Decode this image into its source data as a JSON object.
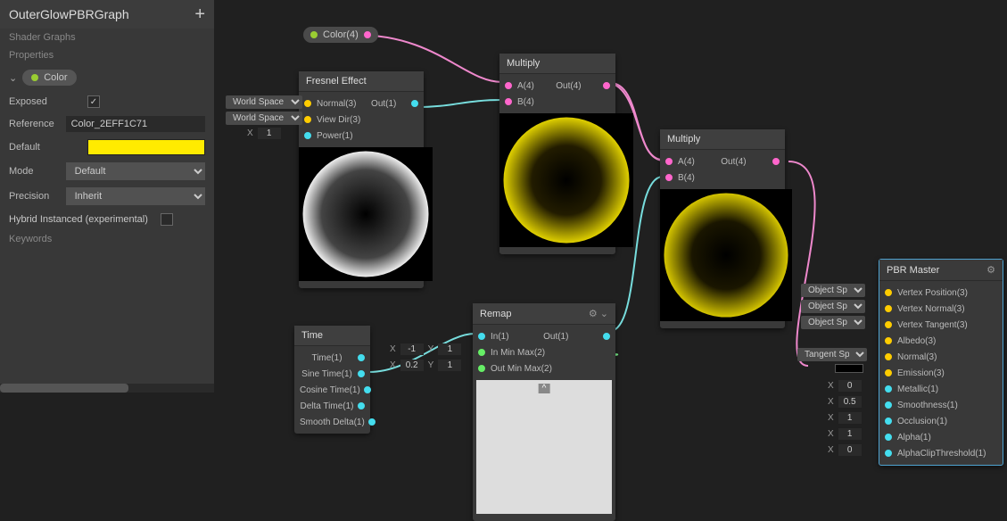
{
  "sidebar": {
    "title": "OuterGlowPBRGraph",
    "subtitle": "Shader Graphs",
    "properties_label": "Properties",
    "keywords_label": "Keywords",
    "pill": {
      "label": "Color"
    },
    "rows": {
      "exposed": "Exposed",
      "reference": "Reference",
      "reference_val": "Color_2EFF1C71",
      "default": "Default",
      "mode": "Mode",
      "mode_val": "Default",
      "precision": "Precision",
      "precision_val": "Inherit",
      "hybrid": "Hybrid Instanced (experimental)"
    }
  },
  "color_pill": {
    "label": "Color(4)"
  },
  "fresnel": {
    "title": "Fresnel Effect",
    "normal": "Normal(3)",
    "view": "View Dir(3)",
    "power": "Power(1)",
    "out": "Out(1)",
    "space1": "World Space",
    "space2": "World Space",
    "power_x": "1",
    "x_lbl": "X"
  },
  "multiply1": {
    "title": "Multiply",
    "a": "A(4)",
    "b": "B(4)",
    "out": "Out(4)"
  },
  "multiply2": {
    "title": "Multiply",
    "a": "A(4)",
    "b": "B(4)",
    "out": "Out(4)"
  },
  "time": {
    "title": "Time",
    "t": "Time(1)",
    "sine": "Sine Time(1)",
    "cos": "Cosine Time(1)",
    "delta": "Delta Time(1)",
    "smooth": "Smooth Delta(1)"
  },
  "remap": {
    "title": "Remap",
    "in": "In(1)",
    "inmm": "In Min Max(2)",
    "outmm": "Out Min Max(2)",
    "out": "Out(1)",
    "in_x": "-1",
    "in_y": "1",
    "out_x": "0.2",
    "out_y": "1",
    "x_lbl": "X",
    "y_lbl": "Y"
  },
  "master": {
    "title": "PBR Master",
    "space_obj": "Object Space",
    "space_obj2": "Object Space",
    "space_obj3": "Object Space",
    "space_tan": "Tangent Space",
    "vpos": "Vertex Position(3)",
    "vnorm": "Vertex Normal(3)",
    "vtan": "Vertex Tangent(3)",
    "albedo": "Albedo(3)",
    "normal": "Normal(3)",
    "emission": "Emission(3)",
    "metallic": "Metallic(1)",
    "smooth": "Smoothness(1)",
    "occ": "Occlusion(1)",
    "alpha": "Alpha(1)",
    "clip": "AlphaClipThreshold(1)",
    "x_lbl": "X",
    "metallic_v": "0",
    "smooth_v": "0.5",
    "occ_v": "1",
    "alpha_v": "1",
    "clip_v": "0"
  }
}
